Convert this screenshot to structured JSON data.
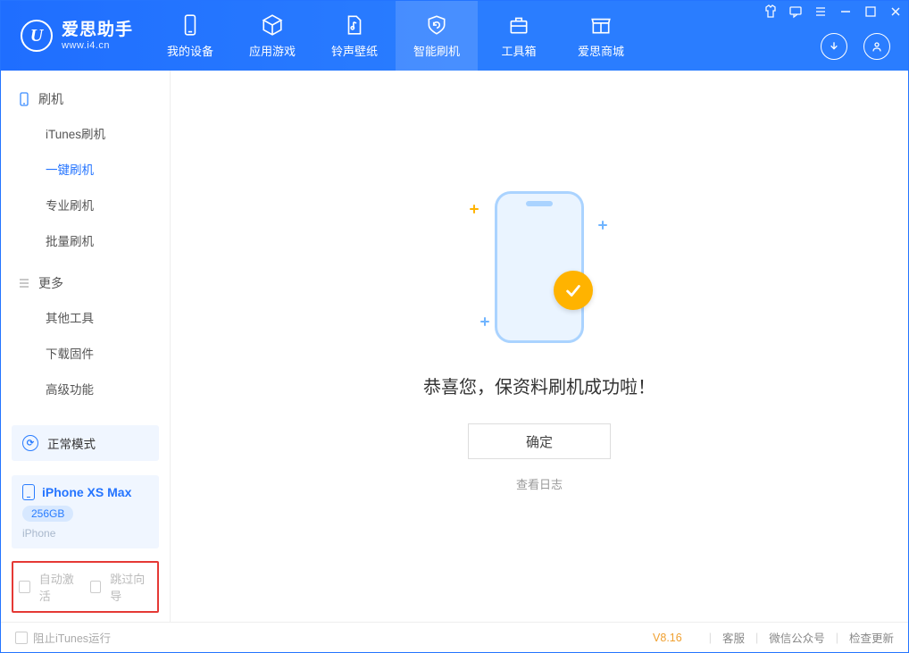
{
  "brand": {
    "title": "爱思助手",
    "subtitle": "www.i4.cn",
    "logo_glyph": "U"
  },
  "header_tabs": [
    {
      "label": "我的设备"
    },
    {
      "label": "应用游戏"
    },
    {
      "label": "铃声壁纸"
    },
    {
      "label": "智能刷机"
    },
    {
      "label": "工具箱"
    },
    {
      "label": "爱思商城"
    }
  ],
  "sidebar": {
    "group_flash": "刷机",
    "items_flash": [
      "iTunes刷机",
      "一键刷机",
      "专业刷机",
      "批量刷机"
    ],
    "group_more": "更多",
    "items_more": [
      "其他工具",
      "下载固件",
      "高级功能"
    ]
  },
  "mode": {
    "label": "正常模式"
  },
  "device": {
    "name": "iPhone XS Max",
    "storage": "256GB",
    "type": "iPhone"
  },
  "bottom_opts": {
    "auto_activate": "自动激活",
    "skip_guide": "跳过向导"
  },
  "main": {
    "success_text": "恭喜您，保资料刷机成功啦！",
    "confirm": "确定",
    "log_link": "查看日志"
  },
  "footer": {
    "block_itunes": "阻止iTunes运行",
    "version": "V8.16",
    "links": [
      "客服",
      "微信公众号",
      "检查更新"
    ]
  }
}
